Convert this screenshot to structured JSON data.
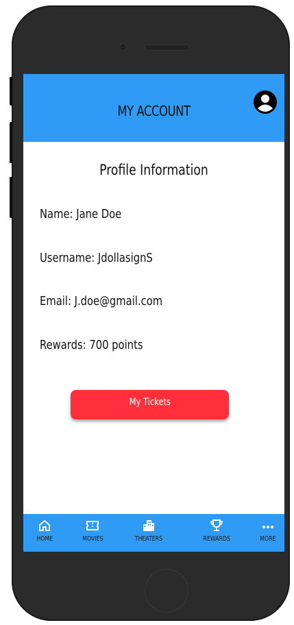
{
  "header": {
    "title": "MY ACCOUNT"
  },
  "profile": {
    "section_title": "Profile Information",
    "name": "Name: Jane Doe",
    "username": "Username: JdollasignS",
    "email": "Email: J.doe@gmail.com",
    "rewards": "Rewards: 700 points"
  },
  "actions": {
    "tickets_label": "My Tickets"
  },
  "nav": {
    "items": [
      {
        "label": "HOME",
        "icon": "home-icon"
      },
      {
        "label": "MOVIES",
        "icon": "ticket-icon"
      },
      {
        "label": "THEATERS",
        "icon": "buildings-icon"
      },
      {
        "label": "REWARDS",
        "icon": "trophy-icon"
      },
      {
        "label": "MORE",
        "icon": "more-icon"
      }
    ]
  },
  "colors": {
    "primary": "#2f9bf5",
    "accent": "#ff303b",
    "phone_body": "#2b2b2b"
  }
}
